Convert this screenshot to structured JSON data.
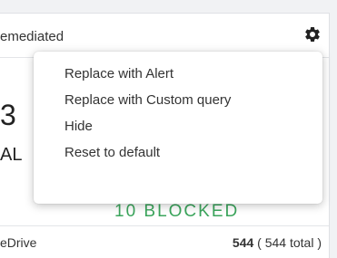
{
  "widget": {
    "title": "emediated",
    "big_number": "3",
    "big_label": "AL",
    "status_text": "10 BLOCKED",
    "row": {
      "name": "eDrive",
      "count": "544",
      "total": "( 544 total )"
    }
  },
  "menu": {
    "items": [
      {
        "label": "Replace with Alert"
      },
      {
        "label": "Replace with Custom query"
      },
      {
        "label": "Hide"
      },
      {
        "label": "Reset to default"
      }
    ]
  },
  "colors": {
    "status_green": "#3ba55c",
    "text": "#333333"
  },
  "icons": {
    "settings": "gear-icon"
  }
}
